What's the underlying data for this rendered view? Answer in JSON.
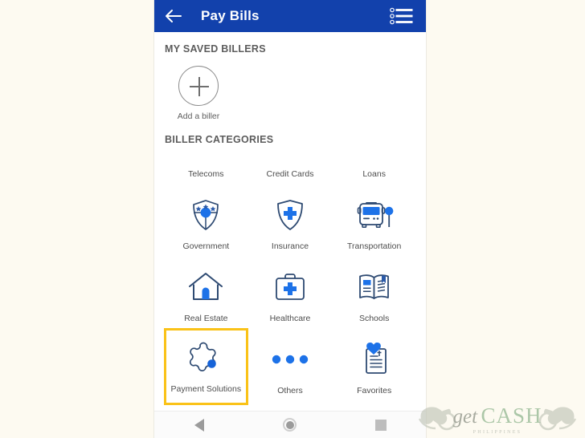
{
  "app": {
    "title": "Pay Bills",
    "back_icon": "arrow-left-icon",
    "menu_icon": "list-menu-icon",
    "header_color": "#1241ac"
  },
  "saved_billers": {
    "section_title": "MY SAVED BILLERS",
    "add_biller": {
      "label": "Add a biller",
      "icon": "plus-circle-icon"
    }
  },
  "biller_categories": {
    "section_title": "BILLER CATEGORIES",
    "highlight_color": "#fac218",
    "items": [
      {
        "label": "Telecoms",
        "icon": "telecoms-icon",
        "icon_visible": false,
        "highlighted": false
      },
      {
        "label": "Credit Cards",
        "icon": "credit-card-icon",
        "icon_visible": false,
        "highlighted": false
      },
      {
        "label": "Loans",
        "icon": "loans-icon",
        "icon_visible": false,
        "highlighted": false
      },
      {
        "label": "Government",
        "icon": "shield-stars-icon",
        "icon_visible": true,
        "highlighted": false
      },
      {
        "label": "Insurance",
        "icon": "shield-cross-icon",
        "icon_visible": true,
        "highlighted": false
      },
      {
        "label": "Transportation",
        "icon": "bus-icon",
        "icon_visible": true,
        "highlighted": false
      },
      {
        "label": "Real Estate",
        "icon": "house-icon",
        "icon_visible": true,
        "highlighted": false
      },
      {
        "label": "Healthcare",
        "icon": "medical-kit-icon",
        "icon_visible": true,
        "highlighted": false
      },
      {
        "label": "Schools",
        "icon": "open-book-icon",
        "icon_visible": true,
        "highlighted": false
      },
      {
        "label": "Payment Solutions",
        "icon": "puzzle-piece-icon",
        "icon_visible": true,
        "highlighted": true
      },
      {
        "label": "Others",
        "icon": "three-dots-icon",
        "icon_visible": true,
        "highlighted": false
      },
      {
        "label": "Favorites",
        "icon": "document-heart-icon",
        "icon_visible": true,
        "highlighted": false
      }
    ]
  },
  "navbar": {
    "back": "back-triangle-icon",
    "home": "home-circle-icon",
    "recents": "recents-square-icon"
  },
  "watermark": {
    "word_get": "get",
    "word_cash": "CASH",
    "subtitle": "PHILIPPINES"
  }
}
